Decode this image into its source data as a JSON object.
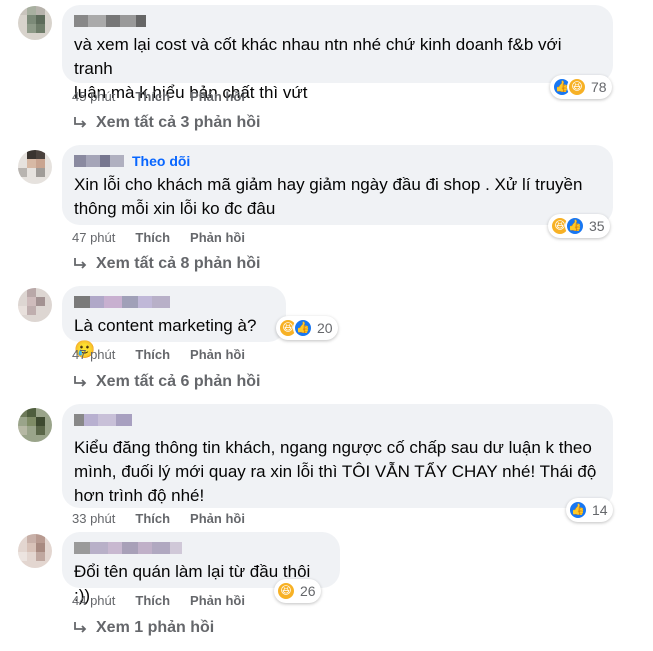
{
  "comments": [
    {
      "follow_label": "",
      "text": "và xem lại cost và cốt khác nhau ntn nhé chứ kinh doanh f&b với tranh\nluận mà k hiểu bản chất thì vứt",
      "time": "45 phút",
      "like_label": "Thích",
      "reply_label": "Phản hồi",
      "reactions": [
        "like",
        "haha"
      ],
      "reaction_count": "78",
      "view_replies": "Xem tất cả 3 phản hồi"
    },
    {
      "follow_label": "Theo dõi",
      "text": "Xin lỗi cho khách mã giảm hay giảm ngày đầu đi shop . Xử lí truyền\nthông mỗi xin lỗi ko đc đâu",
      "time": "47 phút",
      "like_label": "Thích",
      "reply_label": "Phản hồi",
      "reactions": [
        "haha",
        "like"
      ],
      "reaction_count": "35",
      "view_replies": "Xem tất cả 8 phản hồi"
    },
    {
      "follow_label": "",
      "text": "Là content marketing à?🥲",
      "time": "47 phút",
      "like_label": "Thích",
      "reply_label": "Phản hồi",
      "reactions": [
        "haha",
        "like"
      ],
      "reaction_count": "20",
      "view_replies": "Xem tất cả 6 phản hồi"
    },
    {
      "follow_label": "",
      "text": "Kiểu đăng thông tin khách, ngang ngược cố chấp sau dư luận k theo\nmình, đuối lý mới quay ra xin lỗi thì TÔI VẪN TẨY CHAY nhé! Thái độ\nhơn trình độ nhé!",
      "time": "33 phút",
      "like_label": "Thích",
      "reply_label": "Phản hồi",
      "reactions": [
        "like"
      ],
      "reaction_count": "14",
      "view_replies": ""
    },
    {
      "follow_label": "",
      "text": "Đổi tên quán làm lại từ đầu thôi :))",
      "time": "44 phút",
      "like_label": "Thích",
      "reply_label": "Phản hồi",
      "reactions": [
        "haha"
      ],
      "reaction_count": "26",
      "view_replies": "Xem 1 phản hồi"
    }
  ],
  "colors": {
    "link_blue": "#0866ff",
    "bubble_bg": "#f0f2f5",
    "meta_gray": "#65676b",
    "like_blue": "#1877f2",
    "haha_yellow": "#f7b125"
  }
}
